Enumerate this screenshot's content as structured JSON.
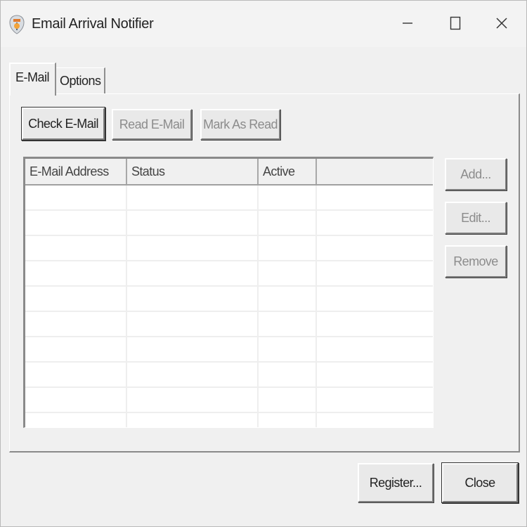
{
  "window": {
    "title": "Email Arrival Notifier",
    "icon": "app-logo-icon",
    "controls": {
      "minimize_icon": "minimize-icon",
      "maximize_icon": "maximize-icon",
      "close_icon": "close-icon"
    }
  },
  "tabs": [
    {
      "label": "E-Mail",
      "selected": true
    },
    {
      "label": "Options",
      "selected": false
    }
  ],
  "toolbar": {
    "check_label": "Check E-Mail",
    "read_label": "Read E-Mail",
    "mark_label": "Mark As Read"
  },
  "list": {
    "columns": [
      "E-Mail Address",
      "Status",
      "Active",
      ""
    ],
    "rows": []
  },
  "side_buttons": {
    "add_label": "Add...",
    "edit_label": "Edit...",
    "remove_label": "Remove"
  },
  "footer": {
    "register_label": "Register...",
    "close_label": "Close"
  },
  "colors": {
    "window_bg": "#f0f0f0",
    "list_bg": "#ffffff",
    "disabled_text": "#8c8c8c"
  }
}
